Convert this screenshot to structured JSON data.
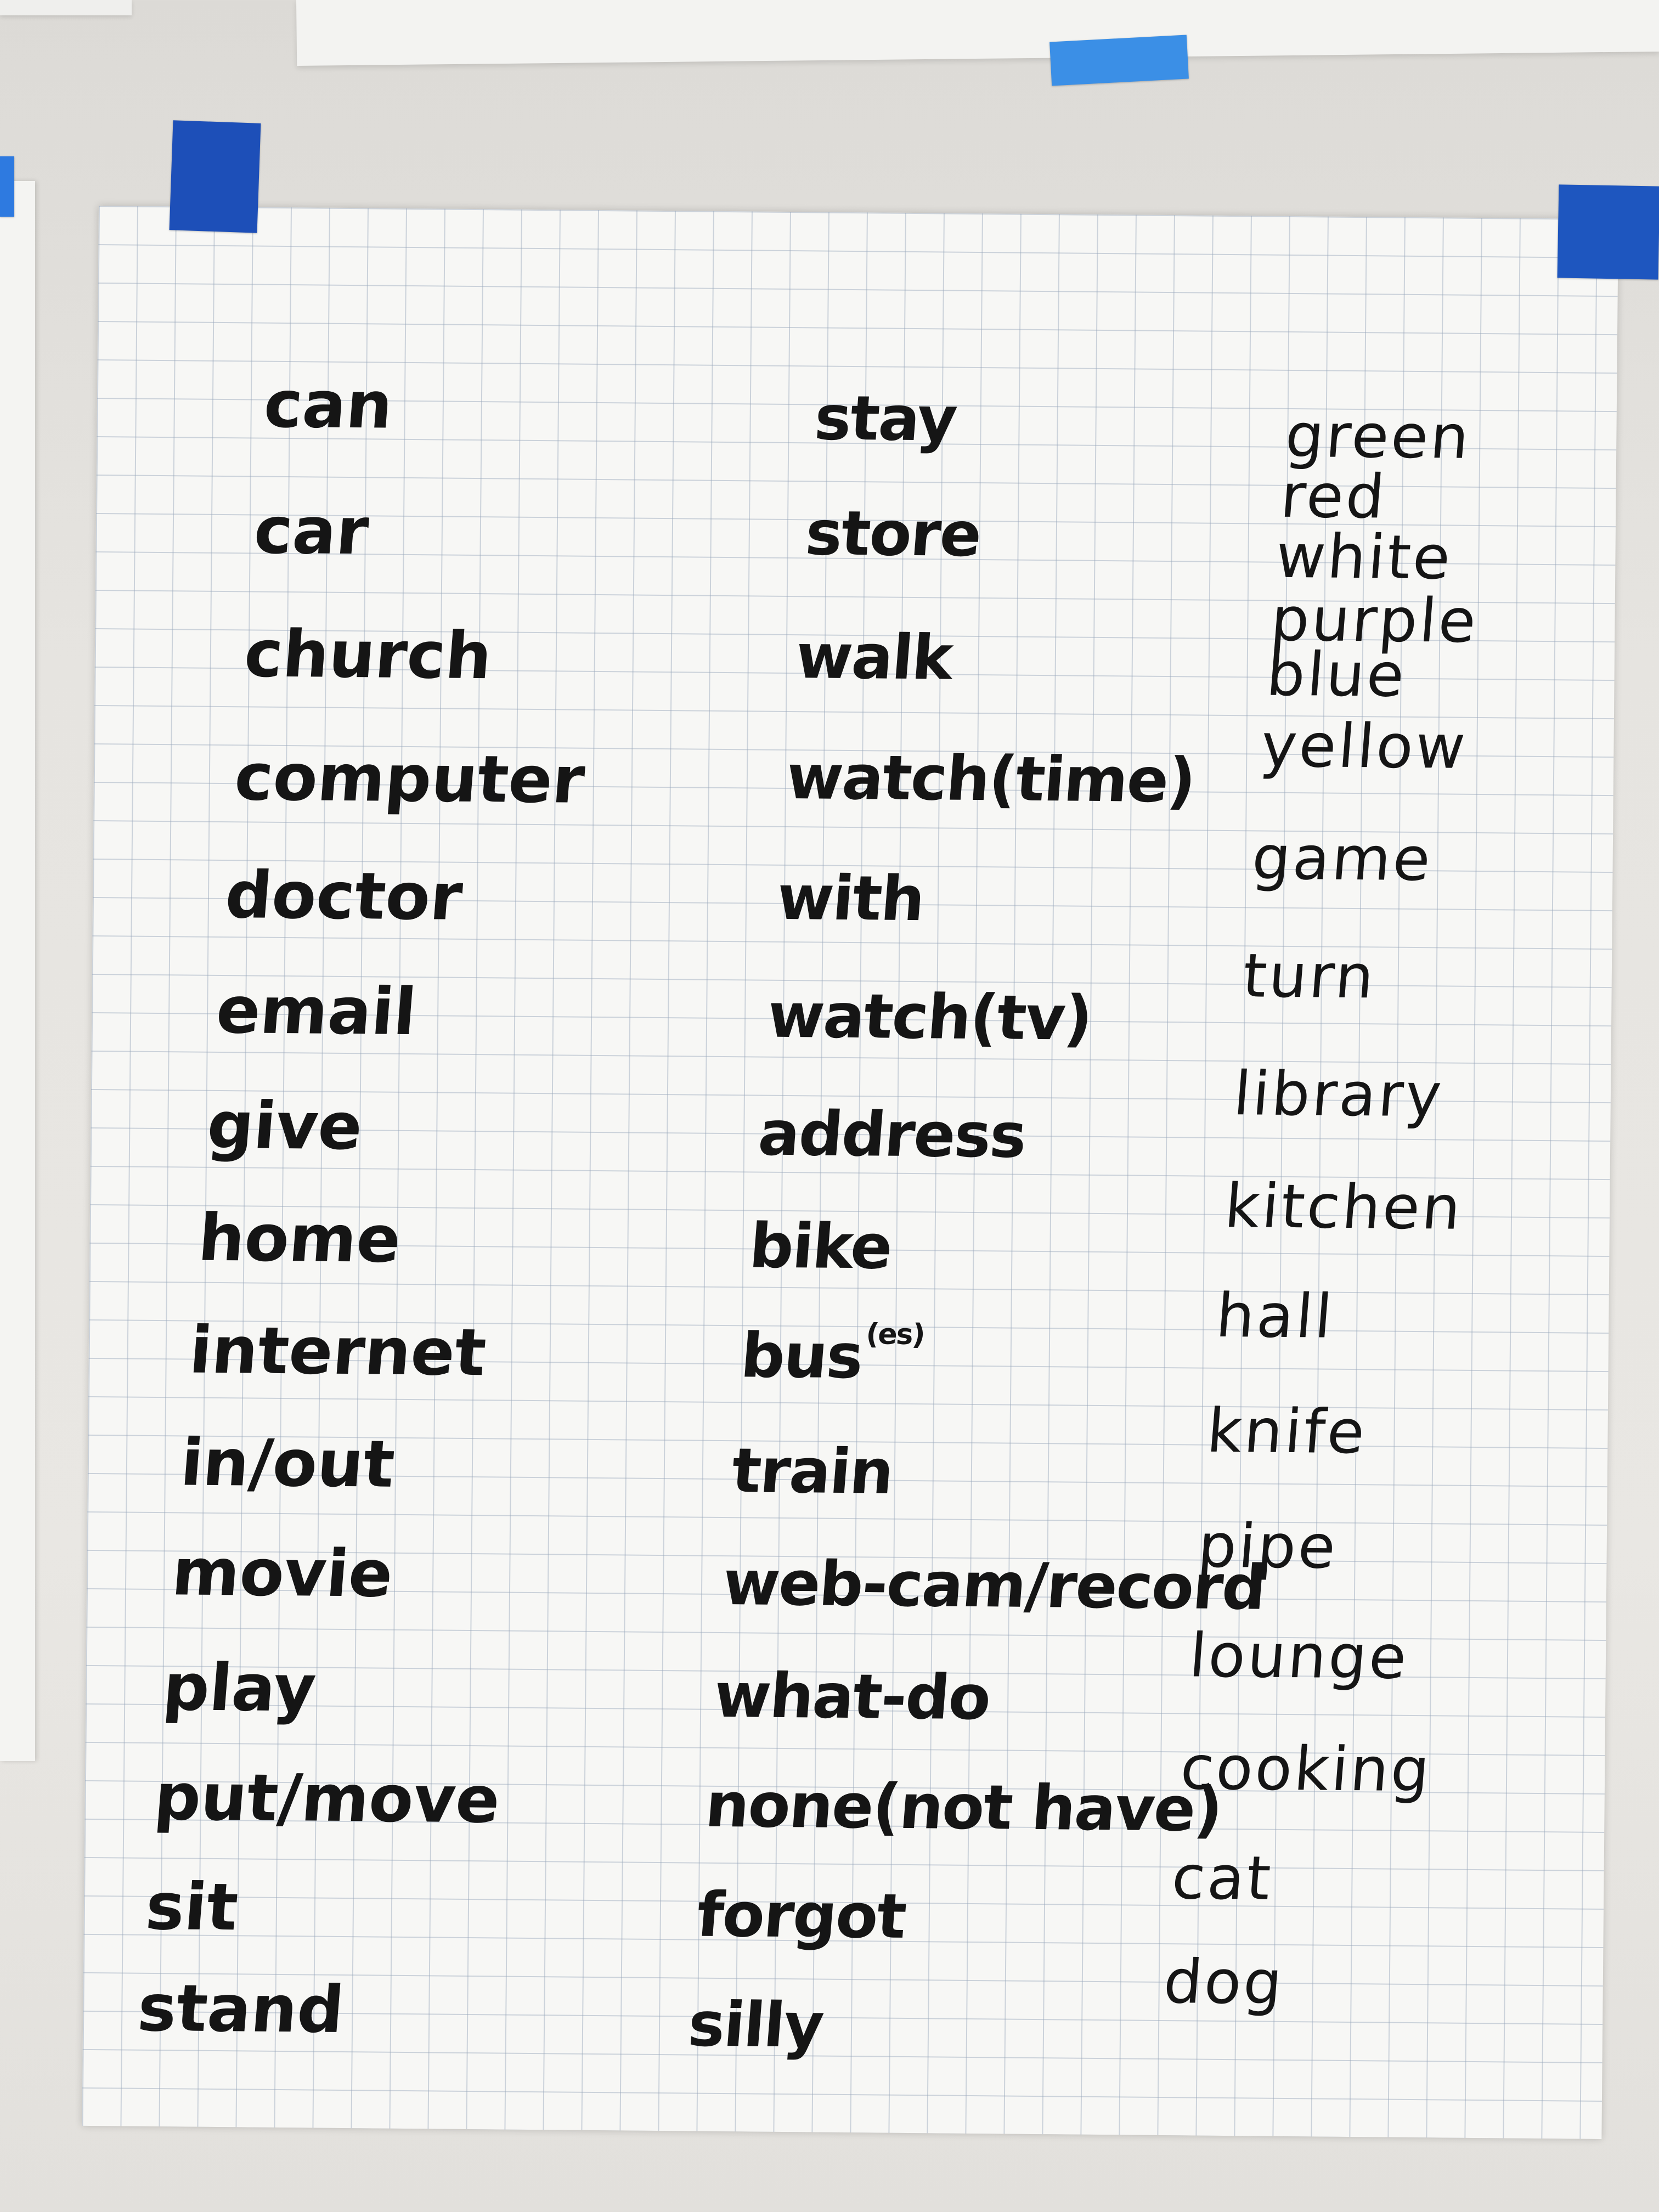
{
  "chart_sheet": {
    "columns": [
      {
        "words": [
          "can",
          "car",
          "church",
          "computer",
          "doctor",
          "email",
          "give",
          "home",
          "internet",
          "in/out",
          "movie",
          "play",
          "put/move",
          "sit",
          "stand"
        ]
      },
      {
        "words": [
          "stay",
          "store",
          "walk",
          "watch(time)",
          "with",
          "watch(tv)",
          "address",
          "bike",
          "bus",
          "train",
          "web-cam/record",
          "what-do",
          "none(not have)",
          "forgot",
          "silly"
        ],
        "superscripts": {
          "bus": "(es)"
        }
      },
      {
        "words": [
          "green",
          "red",
          "white",
          "purple",
          "blue",
          "yellow",
          "game",
          "turn",
          "library",
          "kitchen",
          "hall",
          "knife",
          "pipe",
          "lounge",
          "cooking",
          "cat",
          "dog"
        ]
      }
    ]
  },
  "colors": {
    "ink": "#151515",
    "paper": "#f7f7f5",
    "grid": "#96a5b9",
    "tape": "#1f6fd0",
    "wall": "#e6e4e0"
  }
}
